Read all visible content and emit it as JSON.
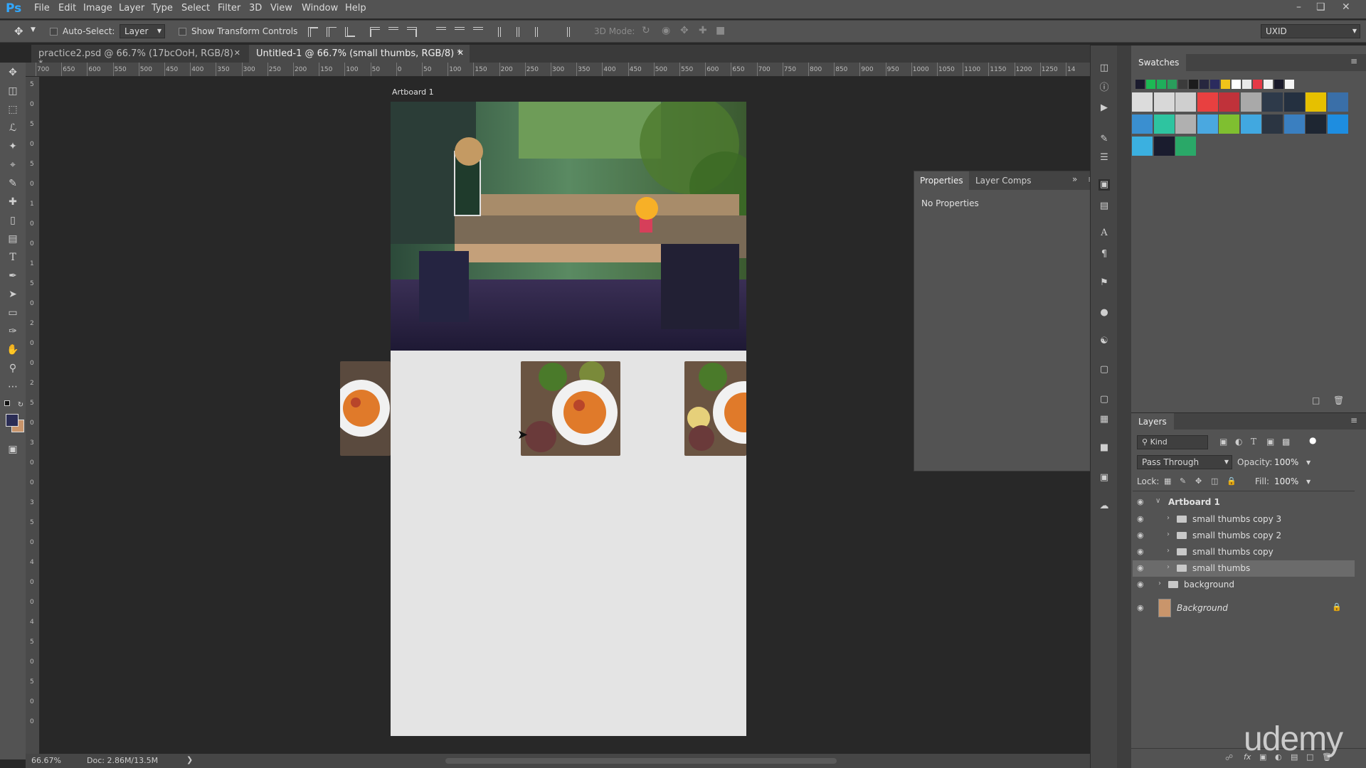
{
  "app": {
    "logo": "Ps"
  },
  "menu": {
    "items": [
      "File",
      "Edit",
      "Image",
      "Layer",
      "Type",
      "Select",
      "Filter",
      "3D",
      "View",
      "Window",
      "Help"
    ]
  },
  "options": {
    "auto_select_label": "Auto-Select:",
    "auto_select_value": "Layer",
    "show_transform_label": "Show Transform Controls",
    "mode_3d_label": "3D Mode:",
    "workspace_value": "UXID"
  },
  "tabs": [
    {
      "label": "practice2.psd @ 66.7% (17bcOoH, RGB/8) *",
      "active": false
    },
    {
      "label": "Untitled-1 @ 66.7% (small thumbs, RGB/8) *",
      "active": true
    }
  ],
  "ruler": {
    "h_labels": [
      "700",
      "650",
      "600",
      "550",
      "500",
      "450",
      "400",
      "350",
      "300",
      "250",
      "200",
      "150",
      "100",
      "50",
      "0",
      "50",
      "100",
      "150",
      "200",
      "250",
      "300",
      "350",
      "400",
      "450",
      "500",
      "550",
      "600",
      "650",
      "700",
      "750",
      "800",
      "850",
      "900",
      "950",
      "1000",
      "1050",
      "1100",
      "1150",
      "1200",
      "1250",
      "14"
    ],
    "v_labels": [
      "5",
      "0",
      "5",
      "0",
      "5",
      "0",
      "1",
      "0",
      "0",
      "1",
      "5",
      "0",
      "2",
      "0",
      "0",
      "2",
      "5",
      "0",
      "3",
      "0",
      "0",
      "3",
      "5",
      "0",
      "4",
      "0",
      "0",
      "4",
      "5",
      "0",
      "5",
      "0",
      "0"
    ]
  },
  "canvas": {
    "artboard_label": "Artboard 1"
  },
  "status": {
    "zoom": "66.67%",
    "doc": "Doc: 2.86M/13.5M"
  },
  "properties": {
    "tabs": [
      "Properties",
      "Layer Comps"
    ],
    "message": "No Properties"
  },
  "swatches": {
    "title": "Swatches",
    "mini": [
      "#1b1b2e",
      "#1db954",
      "#1fae5b",
      "#2a9d5c",
      "#3b3b3b",
      "#1c1c1c",
      "#27273f",
      "#2b2b5e",
      "#f0c419",
      "#ffffff",
      "#e8e8e8",
      "#e63946",
      "#f1f1f1",
      "#1a1a2a",
      "#f4f4f4"
    ],
    "grid": [
      "#dcdcdc",
      "#d8d8d8",
      "#cfcfcf",
      "#e84040",
      "#c0323a",
      "#a9a9a9",
      "#2e3a4a",
      "#243040",
      "#e6c000",
      "#3a6fa8",
      "#3a8fd0",
      "#2ec4a0",
      "#b0b0b0",
      "#4aa8e0",
      "#7fbf30",
      "#41a8e0",
      "#2b3542",
      "#3a7fc0",
      "#1e2632",
      "#1e8de0",
      "#3bb0e0",
      "#1a1c2e",
      "#2aa868"
    ]
  },
  "layers": {
    "title": "Layers",
    "filter_label": "Kind",
    "blend_mode": "Pass Through",
    "opacity_label": "Opacity:",
    "opacity_value": "100%",
    "lock_label": "Lock:",
    "fill_label": "Fill:",
    "fill_value": "100%",
    "items": [
      {
        "name": "Artboard 1",
        "level": 0,
        "kind": "artboard"
      },
      {
        "name": "small thumbs copy 3",
        "level": 1,
        "kind": "group"
      },
      {
        "name": "small thumbs copy 2",
        "level": 1,
        "kind": "group"
      },
      {
        "name": "small thumbs copy",
        "level": 1,
        "kind": "group"
      },
      {
        "name": "small thumbs",
        "level": 1,
        "kind": "group",
        "selected": true
      },
      {
        "name": "background",
        "level": 0,
        "kind": "group"
      },
      {
        "name": "Background",
        "level": 0,
        "kind": "layer",
        "locked": true,
        "italic": true
      }
    ]
  },
  "watermark": "udemy"
}
